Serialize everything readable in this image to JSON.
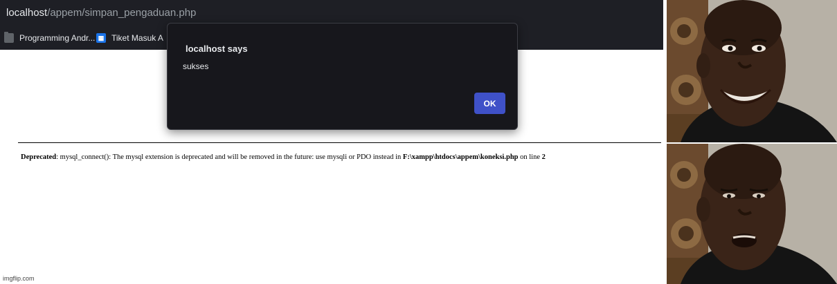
{
  "browser": {
    "address": {
      "host": "localhost",
      "path": "/appem/simpan_pengaduan.php"
    },
    "bookmarks": [
      {
        "label": "Programming Andr...",
        "icon": "folder-icon"
      },
      {
        "label": "Tiket Masuk A",
        "icon": "site-icon"
      }
    ]
  },
  "dialog": {
    "title": "localhost says",
    "message": "sukses",
    "ok_label": "OK"
  },
  "page": {
    "warning": {
      "label": "Deprecated",
      "text": ": mysql_connect(): The mysql extension is deprecated and will be removed in the future: use mysqli or PDO instead in ",
      "path": "F:\\xampp\\htdocs\\appem\\koneksi.php",
      "on_line": " on line ",
      "line": "2"
    }
  },
  "watermark": "imgflip.com",
  "colors": {
    "chrome_bg": "#1e1f25",
    "dialog_bg": "#17171c",
    "ok_button": "#3f51c8",
    "skin": "#3a2418"
  }
}
